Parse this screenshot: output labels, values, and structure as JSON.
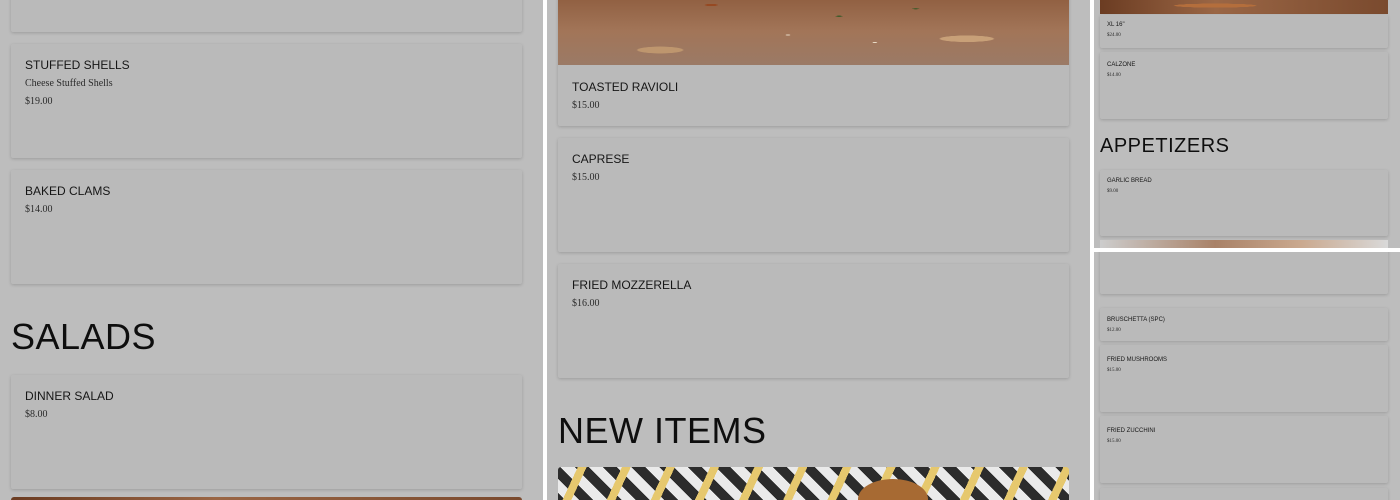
{
  "panel1": {
    "items": [
      {
        "name": "Stuffed Shells",
        "description": "Cheese Stuffed Shells",
        "price": "$19.00"
      },
      {
        "name": "Baked Clams",
        "price": "$14.00"
      }
    ],
    "section_heading": "SALADS",
    "salads": [
      {
        "name": "Dinner Salad",
        "price": "$8.00"
      }
    ]
  },
  "panel2": {
    "items": [
      {
        "name": "Toasted Ravioli",
        "price": "$15.00"
      },
      {
        "name": "Caprese",
        "price": "$15.00"
      },
      {
        "name": "Fried Mozzerella",
        "price": "$16.00"
      }
    ],
    "section_heading": "NEW ITEMS"
  },
  "panel3": {
    "items": [
      {
        "name": "XL 16\"",
        "price": "$24.00"
      },
      {
        "name": "Calzone",
        "price": "$14.00"
      }
    ],
    "section_heading": "APPETIZERS",
    "appetizers": [
      {
        "name": "Garlic Bread",
        "price": "$9.00"
      }
    ]
  },
  "panel4": {
    "items": [
      {
        "name": "Bruschetta (SPC)",
        "price": "$12.00"
      },
      {
        "name": "Fried Mushrooms",
        "price": "$15.00"
      },
      {
        "name": "Fried Zucchini",
        "price": "$15.00"
      }
    ]
  },
  "colors": {
    "overlay_background": "#bdbdbd",
    "card_background": "#bababa",
    "heading_text": "#0e0e0e"
  }
}
